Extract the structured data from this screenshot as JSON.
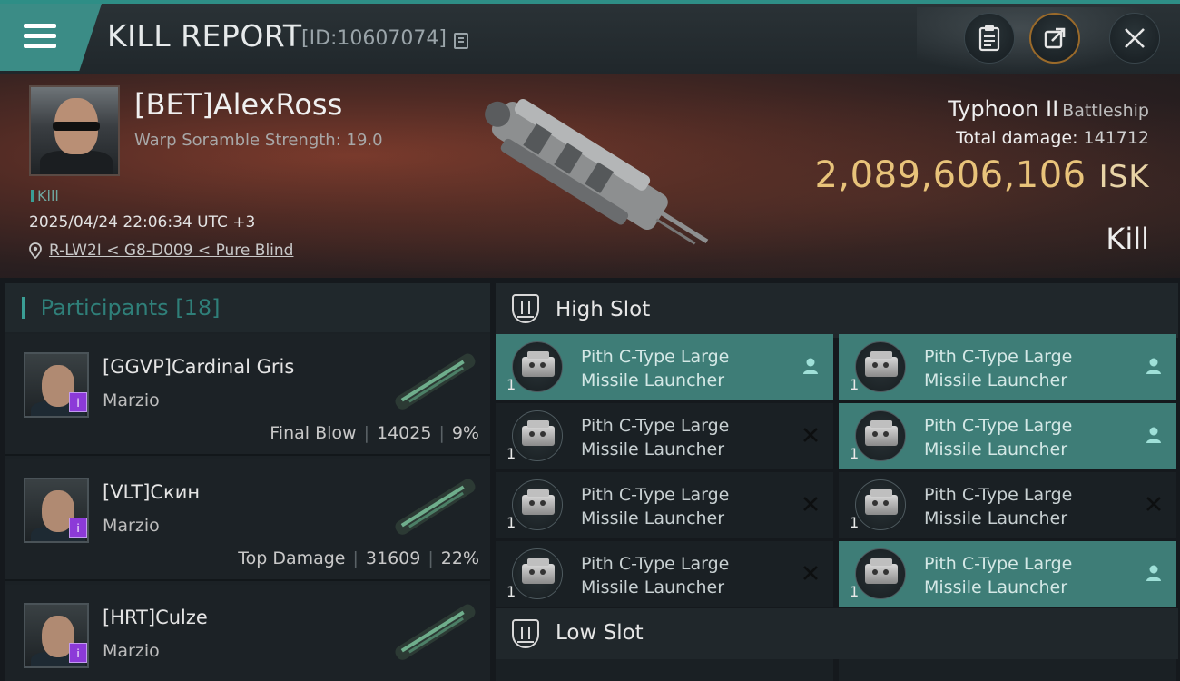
{
  "header": {
    "title": "KILL REPORT",
    "report_id": "[ID:10607074]"
  },
  "victim": {
    "name": "[BET]AlexRoss",
    "warp_scramble": "Warp Soramble Strength: 19.0",
    "kill_tag": "Kill",
    "datetime": "2025/04/24 22:06:34 UTC +3",
    "location": "R-LW2I < G8-D009 < Pure Blind",
    "ship_name": "Typhoon II",
    "ship_class": "Battleship",
    "total_damage_label": "Total damage:",
    "total_damage_value": "141712",
    "isk_value": "2,089,606,106",
    "isk_unit": "ISK",
    "result": "Kill"
  },
  "participants": {
    "title": "Participants",
    "count": "[18]",
    "items": [
      {
        "name": "[GGVP]Cardinal Gris",
        "ship": "Marzio",
        "role": "Final Blow",
        "damage": "14025",
        "percent": "9%"
      },
      {
        "name": "[VLT]Скин",
        "ship": "Marzio",
        "role": "Top Damage",
        "damage": "31609",
        "percent": "22%"
      },
      {
        "name": "[HRT]Culze",
        "ship": "Marzio",
        "role": "",
        "damage": "",
        "percent": ""
      }
    ]
  },
  "slots": {
    "high_title": "High Slot",
    "low_title": "Low Slot",
    "high_modules": [
      {
        "name_line1": "Pith C-Type Large",
        "name_line2": "Missile Launcher",
        "qty": "1",
        "status": "fitted"
      },
      {
        "name_line1": "Pith C-Type Large",
        "name_line2": "Missile Launcher",
        "qty": "1",
        "status": "fitted"
      },
      {
        "name_line1": "Pith C-Type Large",
        "name_line2": "Missile Launcher",
        "qty": "1",
        "status": "destroyed"
      },
      {
        "name_line1": "Pith C-Type Large",
        "name_line2": "Missile Launcher",
        "qty": "1",
        "status": "fitted"
      },
      {
        "name_line1": "Pith C-Type Large",
        "name_line2": "Missile Launcher",
        "qty": "1",
        "status": "destroyed"
      },
      {
        "name_line1": "Pith C-Type Large",
        "name_line2": "Missile Launcher",
        "qty": "1",
        "status": "destroyed"
      },
      {
        "name_line1": "Pith C-Type Large",
        "name_line2": "Missile Launcher",
        "qty": "1",
        "status": "destroyed"
      },
      {
        "name_line1": "Pith C-Type Large",
        "name_line2": "Missile Launcher",
        "qty": "1",
        "status": "fitted"
      }
    ]
  },
  "colors": {
    "accent_teal": "#3b8c86",
    "isk_gold": "#e8c37a",
    "badge_purple": "#8c3ad8"
  }
}
